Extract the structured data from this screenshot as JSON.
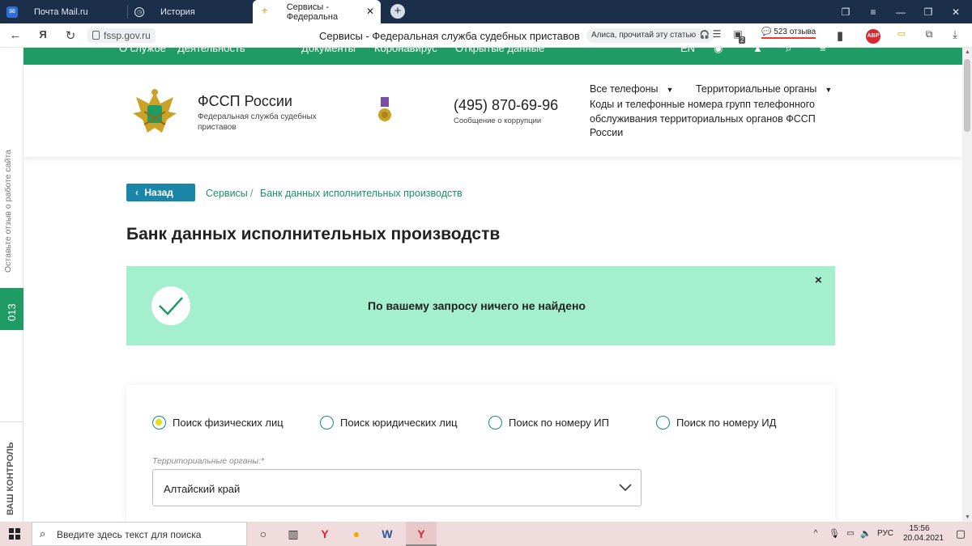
{
  "browser": {
    "tabs": [
      {
        "label": "Почта Mail.ru",
        "active": false
      },
      {
        "label": "История",
        "active": false
      },
      {
        "label": "Сервисы - Федеральна",
        "active": true
      }
    ],
    "url": "fssp.gov.ru",
    "page_title": "Сервисы - Федеральная служба судебных приставов",
    "alice_pill": "Алиса, прочитай эту статью",
    "reviews": "523 отзыва",
    "adblock": "ABP",
    "badge_count": "2"
  },
  "site_nav": {
    "items": [
      "О службе",
      "Деятельность",
      "Документы",
      "Коронавирус",
      "Открытые данные"
    ],
    "lang": "EN"
  },
  "header": {
    "org_name": "ФССП России",
    "org_subtitle": "Федеральная служба судебных приставов",
    "phone": "(495) 870-69-96",
    "phone_subtitle": "Сообщение о коррупции",
    "all_phones": "Все телефоны",
    "territorial": "Территориальные органы",
    "description": "Коды и телефонные номера групп телефонного обслуживания территориальных органов ФССП России"
  },
  "side": {
    "feedback": "Оставьте отзыв о работе сайта",
    "count": "013",
    "vk": "ВАШ КОНТРОЛЬ"
  },
  "breadcrumb": {
    "back": "Назад",
    "services": "Сервисы",
    "separator": "/",
    "current": "Банк данных исполнительных производств"
  },
  "main": {
    "title": "Банк данных исполнительных производств",
    "alert_text": "По вашему запросу ничего не найдено",
    "alert_close": "×"
  },
  "search": {
    "radios": [
      {
        "label": "Поиск физических лиц",
        "selected": true
      },
      {
        "label": "Поиск юридических лиц",
        "selected": false
      },
      {
        "label": "Поиск по номеру ИП",
        "selected": false
      },
      {
        "label": "Поиск по номеру ИД",
        "selected": false
      }
    ],
    "territory_label": "Территориальные органы:*",
    "territory_value": "Алтайский край"
  },
  "taskbar": {
    "search_placeholder": "Введите здесь текст для поиска",
    "lang": "РУС",
    "time": "15:56",
    "date": "20.04.2021"
  },
  "colors": {
    "brand_green": "#1f9c65",
    "alert_bg": "#a3efce",
    "back_btn": "#1a87a8",
    "link": "#1a9166"
  }
}
